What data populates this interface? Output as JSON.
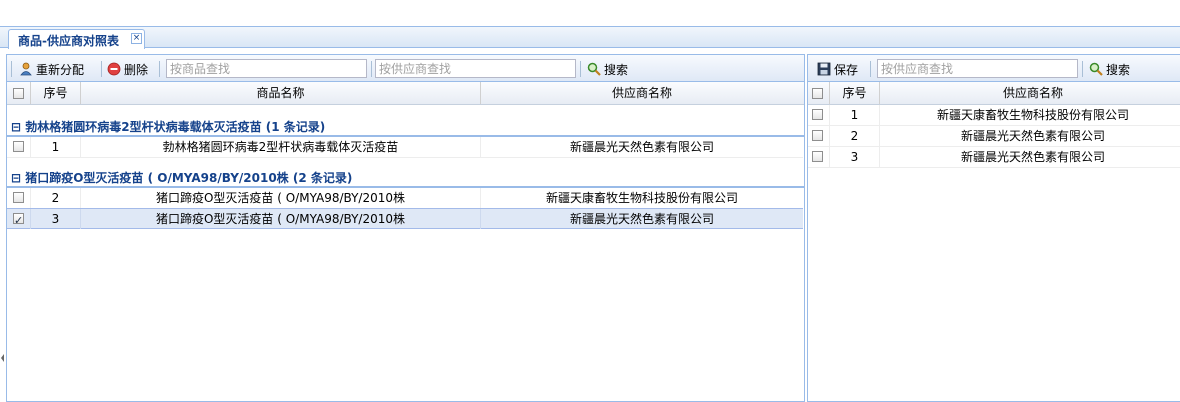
{
  "tab": {
    "label": "商品-供应商对照表",
    "close_glyph": "×"
  },
  "left": {
    "toolbar": {
      "reassign_label": "重新分配",
      "delete_label": "删除",
      "product_search_placeholder": "按商品查找",
      "supplier_search_placeholder": "按供应商查找",
      "search_label": "搜索"
    },
    "columns": {
      "index": "序号",
      "product": "商品名称",
      "supplier": "供应商名称"
    },
    "groups": [
      {
        "title": "勃林格猪圆环病毒2型杆状病毒载体灭活疫苗 (1 条记录)",
        "rows": [
          {
            "index": "1",
            "product": "勃林格猪圆环病毒2型杆状病毒载体灭活疫苗",
            "supplier": "新疆晨光天然色素有限公司",
            "checked": false
          }
        ]
      },
      {
        "title": "猪口蹄疫O型灭活疫苗 ( O/MYA98/BY/2010株 (2 条记录)",
        "rows": [
          {
            "index": "2",
            "product": "猪口蹄疫O型灭活疫苗 ( O/MYA98/BY/2010株",
            "supplier": "新疆天康畜牧生物科技股份有限公司",
            "checked": false
          },
          {
            "index": "3",
            "product": "猪口蹄疫O型灭活疫苗 ( O/MYA98/BY/2010株",
            "supplier": "新疆晨光天然色素有限公司",
            "checked": true
          }
        ]
      }
    ]
  },
  "right": {
    "toolbar": {
      "save_label": "保存",
      "supplier_search_placeholder": "按供应商查找",
      "search_label": "搜索"
    },
    "columns": {
      "index": "序号",
      "supplier": "供应商名称"
    },
    "rows": [
      {
        "index": "1",
        "supplier": "新疆天康畜牧生物科技股份有限公司"
      },
      {
        "index": "2",
        "supplier": "新疆晨光天然色素有限公司"
      },
      {
        "index": "3",
        "supplier": "新疆晨光天然色素有限公司"
      }
    ]
  },
  "colors": {
    "header_blue": "#15428b",
    "border_blue": "#99bbe8",
    "selected_row": "#dfe8f6"
  },
  "icons": [
    "reassign-icon",
    "delete-icon",
    "search-icon",
    "save-icon",
    "collapse-icon",
    "close-icon"
  ]
}
